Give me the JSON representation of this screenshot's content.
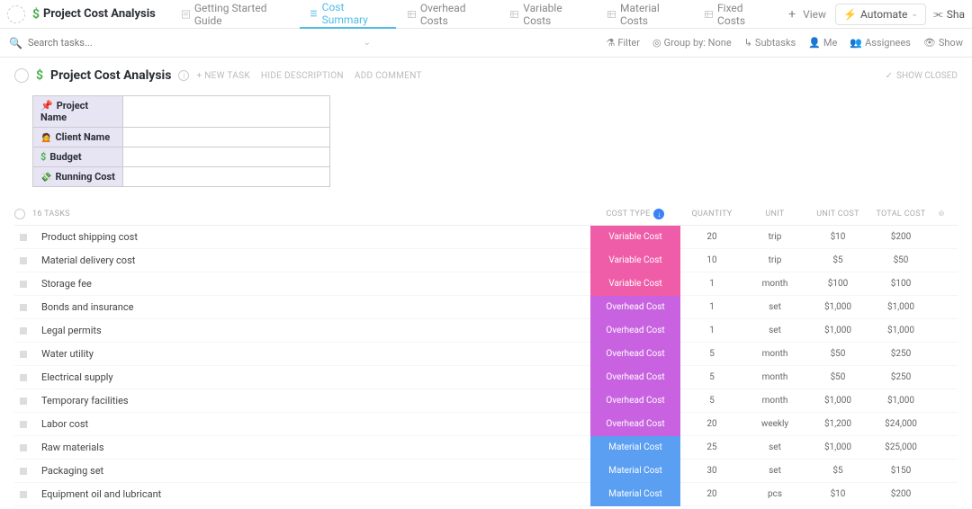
{
  "header": {
    "title": "Project Cost Analysis",
    "tabs": [
      {
        "label": "Getting Started Guide"
      },
      {
        "label": "Cost Summary"
      },
      {
        "label": "Overhead Costs"
      },
      {
        "label": "Variable Costs"
      },
      {
        "label": "Material Costs"
      },
      {
        "label": "Fixed Costs"
      }
    ],
    "addView": "View",
    "automate": "Automate",
    "share": "Sha"
  },
  "filterbar": {
    "searchPlaceholder": "Search tasks...",
    "filter": "Filter",
    "groupBy": "Group by: None",
    "subtasks": "Subtasks",
    "me": "Me",
    "assignees": "Assignees",
    "show": "Show"
  },
  "subheader": {
    "title": "Project Cost Analysis",
    "newTask": "+ NEW TASK",
    "hideDesc": "HIDE DESCRIPTION",
    "addComment": "ADD COMMENT",
    "showClosed": "SHOW CLOSED"
  },
  "infoTable": {
    "projectName": "Project Name",
    "clientName": "Client Name",
    "budget": "Budget",
    "runningCost": "Running Cost"
  },
  "taskHeader": {
    "count": "16 TASKS",
    "costType": "COST TYPE",
    "quantity": "QUANTITY",
    "unit": "UNIT",
    "unitCost": "UNIT COST",
    "totalCost": "TOTAL COST"
  },
  "tasks": [
    {
      "name": "Product shipping cost",
      "type": "Variable Cost",
      "class": "variable",
      "qty": "20",
      "unit": "trip",
      "unitCost": "$10",
      "total": "$200"
    },
    {
      "name": "Material delivery cost",
      "type": "Variable Cost",
      "class": "variable",
      "qty": "10",
      "unit": "trip",
      "unitCost": "$5",
      "total": "$50"
    },
    {
      "name": "Storage fee",
      "type": "Variable Cost",
      "class": "variable",
      "qty": "1",
      "unit": "month",
      "unitCost": "$100",
      "total": "$100"
    },
    {
      "name": "Bonds and insurance",
      "type": "Overhead Cost",
      "class": "overhead",
      "qty": "1",
      "unit": "set",
      "unitCost": "$1,000",
      "total": "$1,000"
    },
    {
      "name": "Legal permits",
      "type": "Overhead Cost",
      "class": "overhead",
      "qty": "1",
      "unit": "set",
      "unitCost": "$1,000",
      "total": "$1,000"
    },
    {
      "name": "Water utility",
      "type": "Overhead Cost",
      "class": "overhead",
      "qty": "5",
      "unit": "month",
      "unitCost": "$50",
      "total": "$250"
    },
    {
      "name": "Electrical supply",
      "type": "Overhead Cost",
      "class": "overhead",
      "qty": "5",
      "unit": "month",
      "unitCost": "$50",
      "total": "$250"
    },
    {
      "name": "Temporary facilities",
      "type": "Overhead Cost",
      "class": "overhead",
      "qty": "5",
      "unit": "month",
      "unitCost": "$1,000",
      "total": "$1,000"
    },
    {
      "name": "Labor cost",
      "type": "Overhead Cost",
      "class": "overhead",
      "qty": "20",
      "unit": "weekly",
      "unitCost": "$1,200",
      "total": "$24,000"
    },
    {
      "name": "Raw materials",
      "type": "Material Cost",
      "class": "material",
      "qty": "25",
      "unit": "set",
      "unitCost": "$1,000",
      "total": "$25,000"
    },
    {
      "name": "Packaging set",
      "type": "Material Cost",
      "class": "material",
      "qty": "30",
      "unit": "set",
      "unitCost": "$5",
      "total": "$150"
    },
    {
      "name": "Equipment oil and lubricant",
      "type": "Material Cost",
      "class": "material",
      "qty": "20",
      "unit": "pcs",
      "unitCost": "$10",
      "total": "$200"
    }
  ]
}
